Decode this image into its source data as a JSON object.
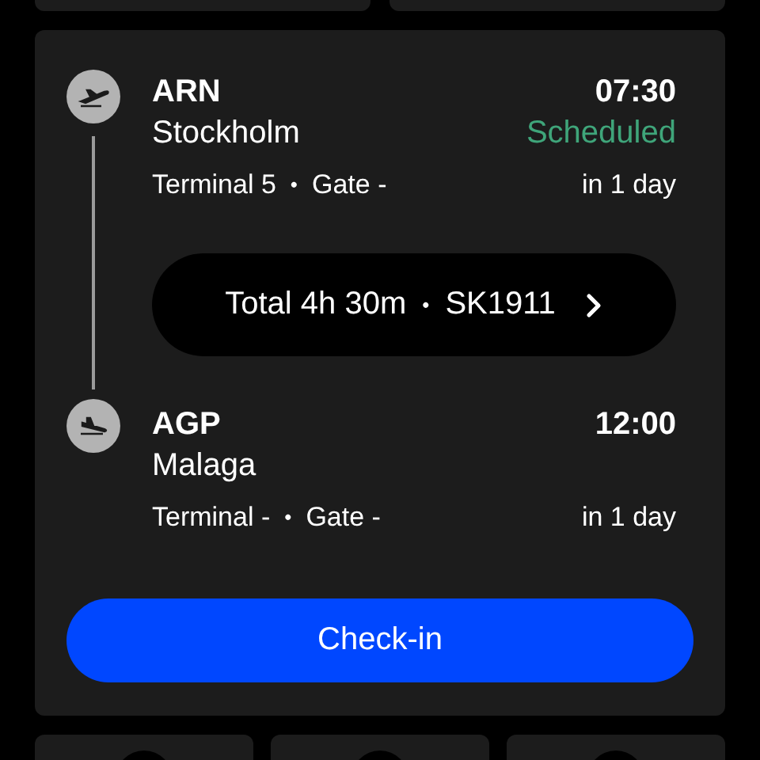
{
  "flight": {
    "stops": [
      {
        "kind": "departure",
        "code": "ARN",
        "city": "Stockholm",
        "time": "07:30",
        "status": "Scheduled",
        "color": "#3fa57a",
        "terminal": "Terminal 5",
        "separator": "•",
        "gate": "Gate -",
        "relative": "in 1 day"
      },
      {
        "kind": "arrival",
        "code": "AGP",
        "city": "Malaga",
        "time": "12:00",
        "terminal": "Terminal -",
        "separator": "•",
        "gate": "Gate -",
        "relative": "in 1 day"
      }
    ],
    "summary": {
      "duration": "Total 4h 30m",
      "separator": "•",
      "flight_number": "SK1911"
    },
    "button": "Check-in"
  }
}
